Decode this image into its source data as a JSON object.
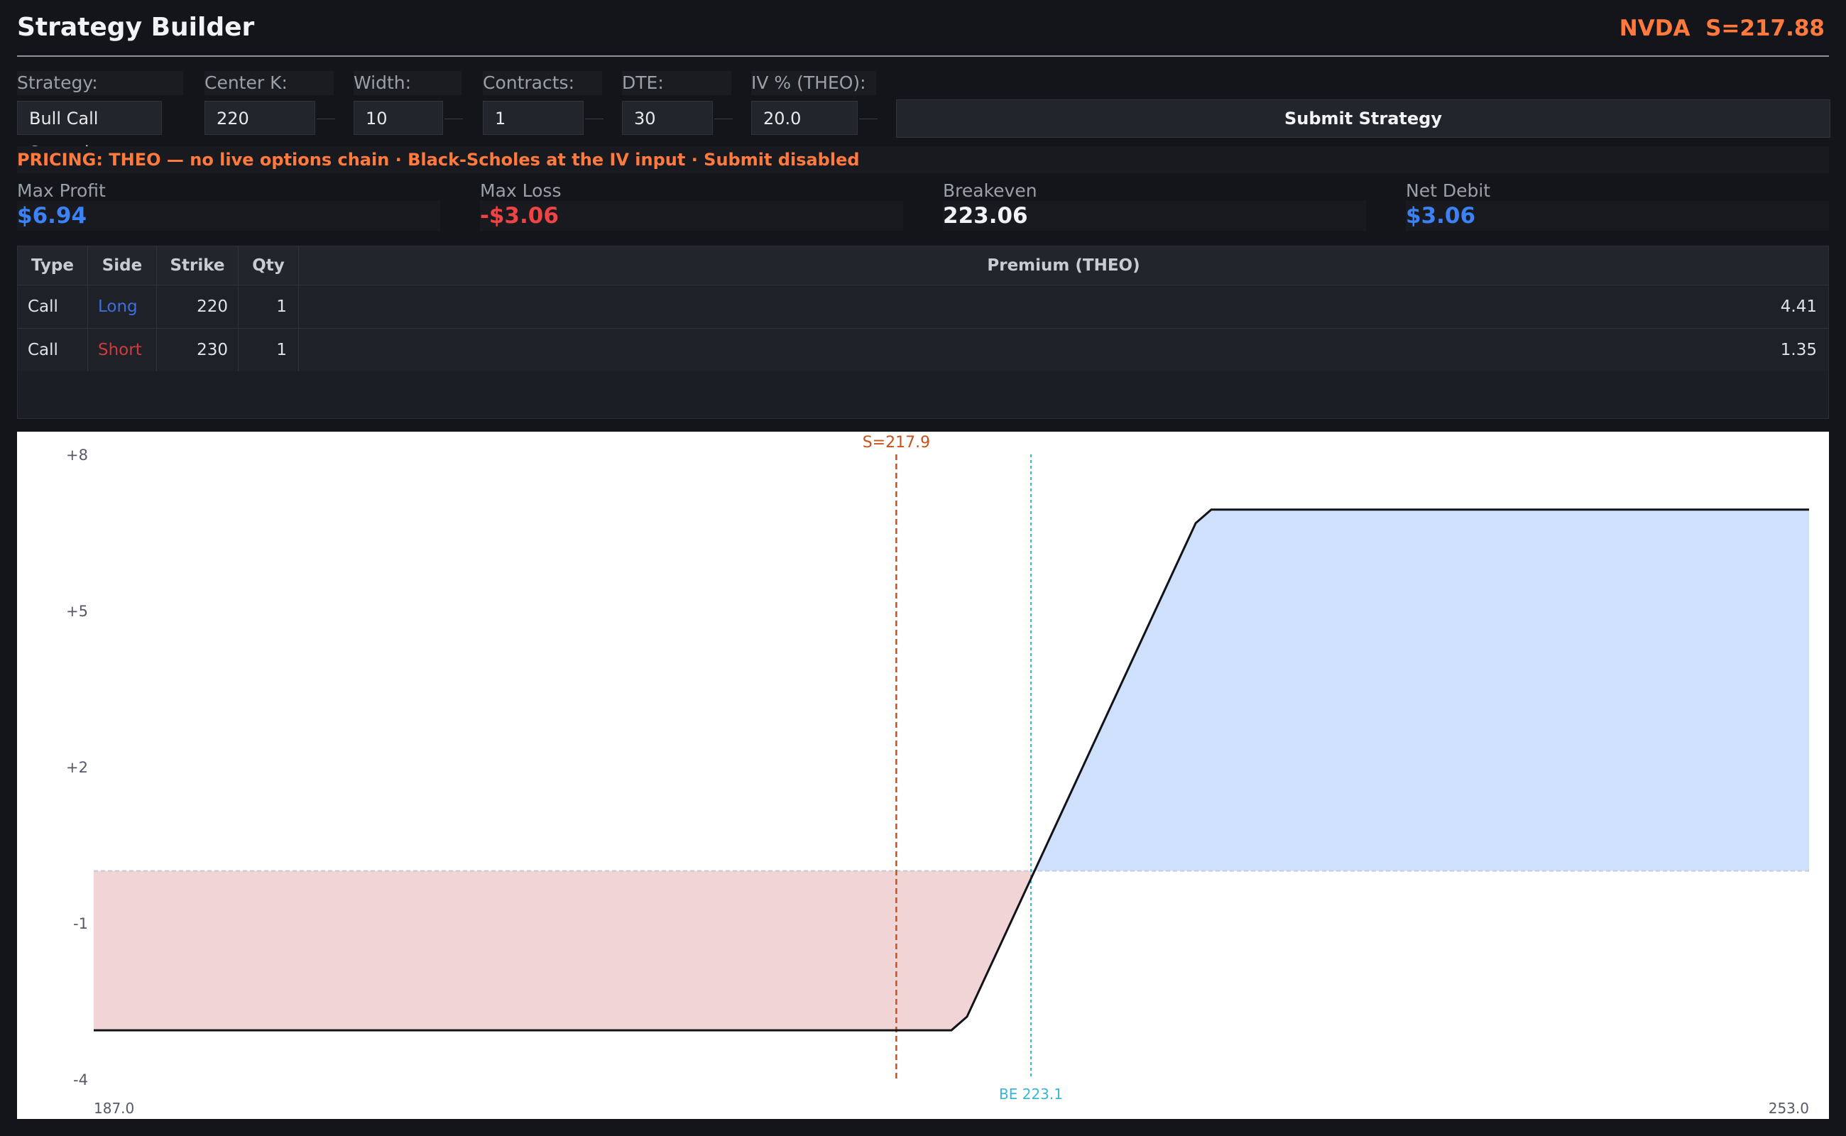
{
  "header": {
    "title": "Strategy Builder",
    "ticker": "NVDA",
    "spot_label": "S=217.88"
  },
  "controls": {
    "strategy": {
      "label": "Strategy:",
      "value": "Bull Call Spread"
    },
    "center_k": {
      "label": "Center K:",
      "value": "220"
    },
    "width": {
      "label": "Width:",
      "value": "10"
    },
    "contracts": {
      "label": "Contracts:",
      "value": "1"
    },
    "dte": {
      "label": "DTE:",
      "value": "30"
    },
    "iv": {
      "label": "IV % (THEO):",
      "value": "20.0"
    },
    "submit_label": "Submit Strategy"
  },
  "pricing_notice": "PRICING: THEO — no live options chain · Black-Scholes at the IV input · Submit disabled",
  "metrics": {
    "max_profit": {
      "label": "Max Profit",
      "value": "$6.94"
    },
    "max_loss": {
      "label": "Max Loss",
      "value": "-$3.06"
    },
    "breakeven": {
      "label": "Breakeven",
      "value": "223.06"
    },
    "net_debit": {
      "label": "Net Debit",
      "value": "$3.06"
    }
  },
  "legs_table": {
    "headers": [
      "Type",
      "Side",
      "Strike",
      "Qty",
      "Premium (THEO)"
    ],
    "rows": [
      [
        "Call",
        "Long",
        "220",
        "1",
        "4.41"
      ],
      [
        "Call",
        "Short",
        "230",
        "1",
        "1.35"
      ]
    ]
  },
  "colors": {
    "accent": "#ff7a3c",
    "profit": "#3b82f6",
    "loss": "#ef4444",
    "long": "#3b6fe0",
    "short": "#d13a3a",
    "profit_fill": "#cfe0fc",
    "loss_fill": "#f1d5d6",
    "spot_line": "#c8521e",
    "breakeven_line": "#39b6d8"
  },
  "chart_data": {
    "type": "area",
    "x": [
      187.0,
      220.0,
      220.6,
      229.4,
      230.0,
      253.0
    ],
    "y": [
      -3.06,
      -3.06,
      -2.8,
      6.68,
      6.94,
      6.94
    ],
    "xlim": [
      187.0,
      253.0
    ],
    "ylim": [
      -4,
      8
    ],
    "x_tick_labels": [
      "187.0",
      "253.0"
    ],
    "y_tick_labels": [
      "+8",
      "+5",
      "+2",
      "-1",
      "-4"
    ],
    "y_ticks": [
      8,
      5,
      2,
      -1,
      -4
    ],
    "spot": 217.88,
    "spot_label": "S=217.9",
    "breakeven": 223.06,
    "breakeven_label": "BE 223.1",
    "grid": false
  }
}
